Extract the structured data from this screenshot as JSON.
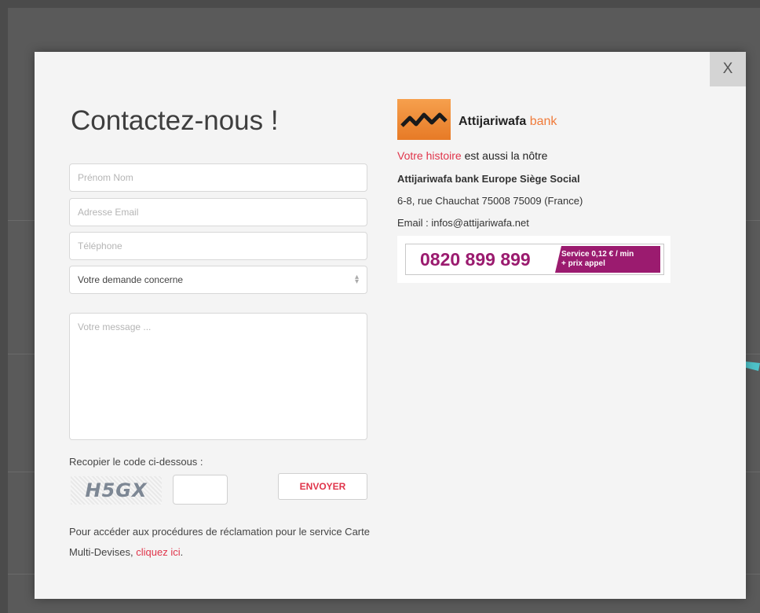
{
  "modal": {
    "close_label": "X",
    "title": "Contactez-nous !",
    "form": {
      "name_placeholder": "Prénom Nom",
      "email_placeholder": "Adresse Email",
      "phone_placeholder": "Téléphone",
      "subject_select": "Votre demande concerne",
      "message_placeholder": "Votre message ...",
      "captcha_label": "Recopier le code ci-dessous :",
      "captcha_code": "H5GX",
      "send_label": "ENVOYER",
      "reclamation_text": "Pour accéder aux procédures de réclamation pour le service Carte Multi-Devises,",
      "reclamation_link": "cliquez ici",
      "reclamation_end": "."
    },
    "contact": {
      "brand_name": "Attijariwafa",
      "brand_suffix": "bank",
      "slogan_accent": "Votre histoire",
      "slogan_rest": "est aussi la nôtre",
      "headquarters": "Attijariwafa bank Europe Siège Social",
      "address": "6-8, rue Chauchat 75008 75009 (France)",
      "email": "Email : infos@attijariwafa.net",
      "phone_number": "0820 899 899",
      "phone_tag_line1": "Service 0,12 € / min",
      "phone_tag_line2": "+ prix appel"
    }
  },
  "colors": {
    "accent": "#e0344a",
    "brand_orange": "#f07b3a",
    "phone_purple": "#9b1b6f",
    "overlay": "#4b4b4b",
    "arrow_teal": "#4ec3c9"
  }
}
